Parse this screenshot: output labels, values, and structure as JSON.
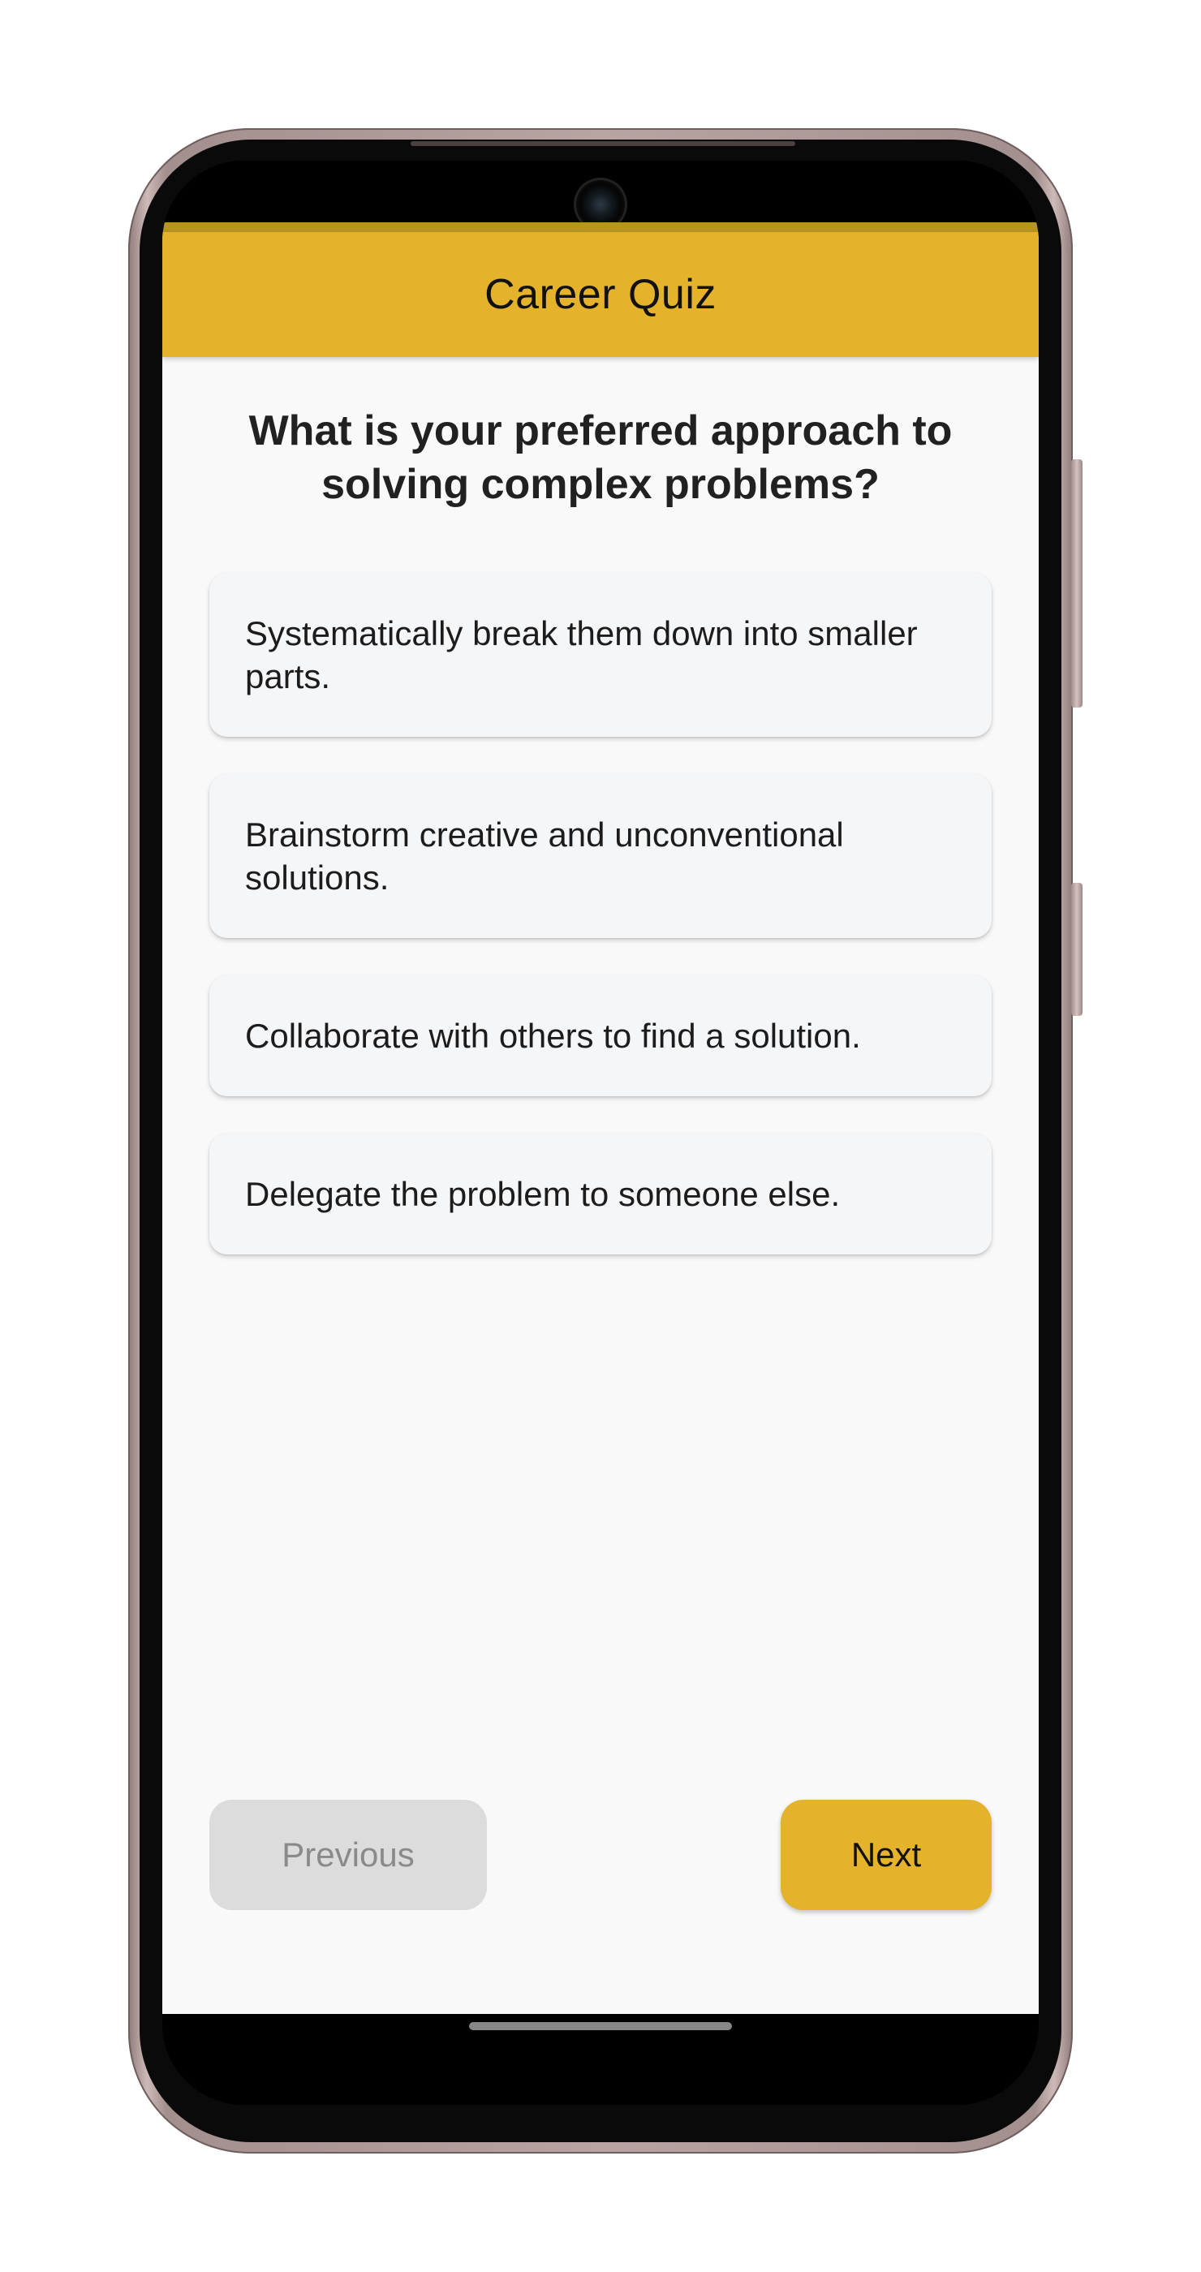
{
  "app_bar": {
    "title": "Career Quiz"
  },
  "quiz": {
    "question": "What is your preferred approach to solving complex problems?",
    "options": [
      "Systematically break them down into smaller parts.",
      "Brainstorm creative and unconventional solutions.",
      "Collaborate with others to find a solution.",
      "Delegate the problem to someone else."
    ]
  },
  "navigation": {
    "previous_label": "Previous",
    "next_label": "Next"
  },
  "colors": {
    "accent": "#e5b32b",
    "background": "#f9f9f9",
    "option_card": "#f5f6f8",
    "disabled_button": "#dcdcdc"
  },
  "icons": {
    "camera": "front-camera-icon"
  }
}
